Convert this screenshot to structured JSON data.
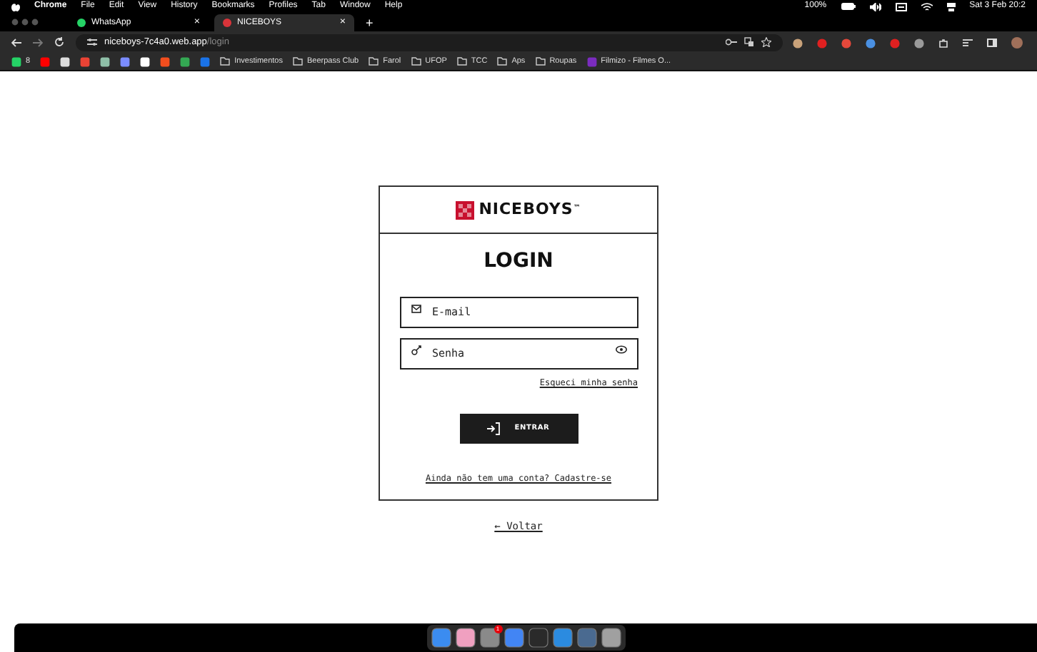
{
  "menu_bar": {
    "app": "Chrome",
    "items": [
      "File",
      "Edit",
      "View",
      "History",
      "Bookmarks",
      "Profiles",
      "Tab",
      "Window",
      "Help"
    ],
    "battery": "100%",
    "clock": "Sat 3 Feb 20:2"
  },
  "tabs": [
    {
      "title": "WhatsApp",
      "close": "×",
      "selected": false,
      "color": "#25d366"
    },
    {
      "title": "NICEBOYS",
      "close": "×",
      "selected": true,
      "color": "#d9343a"
    }
  ],
  "new_tab": "+",
  "address_bar": {
    "host": "niceboys-7c4a0.web.app",
    "path": "/login"
  },
  "bookmarks": [
    {
      "kind": "app",
      "label": "8",
      "color": "#25d366"
    },
    {
      "kind": "app",
      "color": "#ff0000"
    },
    {
      "kind": "app",
      "color": "#dddddd"
    },
    {
      "kind": "app",
      "color": "#ea4335"
    },
    {
      "kind": "app",
      "color": "#8fbfa8"
    },
    {
      "kind": "app",
      "color": "#7b8cff"
    },
    {
      "kind": "app",
      "color": "#ffffff"
    },
    {
      "kind": "app",
      "color": "#f24e1e"
    },
    {
      "kind": "app",
      "color": "#34a853"
    },
    {
      "kind": "app",
      "color": "#1a73e8"
    },
    {
      "kind": "folder",
      "label": "Investimentos"
    },
    {
      "kind": "folder",
      "label": "Beerpass Club"
    },
    {
      "kind": "folder",
      "label": "Farol"
    },
    {
      "kind": "folder",
      "label": "UFOP"
    },
    {
      "kind": "folder",
      "label": "TCC"
    },
    {
      "kind": "folder",
      "label": "Aps"
    },
    {
      "kind": "folder",
      "label": "Roupas"
    },
    {
      "kind": "app",
      "label": "Filmizo - Filmes O...",
      "color": "#7b2cbf"
    }
  ],
  "extensions": [
    {
      "color": "#c9a27a"
    },
    {
      "color": "#e02020"
    },
    {
      "color": "#e5483b"
    },
    {
      "color": "#4a90e2"
    },
    {
      "color": "#e02020"
    },
    {
      "color": "#9a9a9a"
    }
  ],
  "login": {
    "brand": "NICEBOYS",
    "trademark": "™",
    "title": "LOGIN",
    "email": {
      "placeholder": "E-mail"
    },
    "password": {
      "placeholder": "Senha"
    },
    "forgot": "Esqueci minha senha",
    "submit": "ENTRAR",
    "signup": "Ainda não tem uma conta? Cadastre-se"
  },
  "back_link": "← Voltar",
  "dock": [
    {
      "color": "#3b8cf0"
    },
    {
      "color": "#f0a0c0"
    },
    {
      "color": "#8a8a8a",
      "badge": "1"
    },
    {
      "color": "#4285f4"
    },
    {
      "color": "#2a2a2a"
    },
    {
      "color": "#2b8be0"
    },
    {
      "color": "#4a6a90"
    },
    {
      "color": "#a0a0a0"
    }
  ]
}
